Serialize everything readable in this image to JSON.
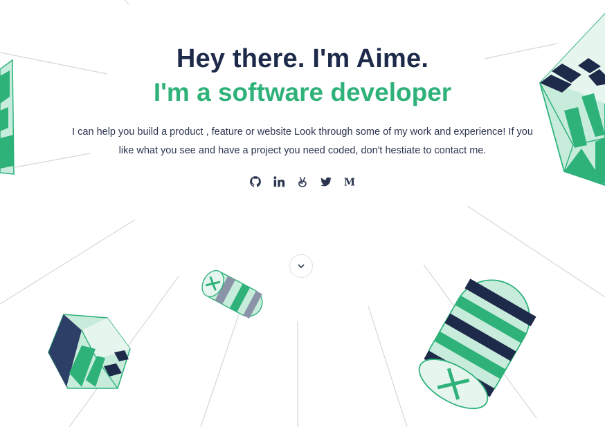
{
  "hero": {
    "greeting": "Hey there. I'm Aime.",
    "role": "I'm a software developer",
    "intro": "I can help you build a product , feature or website Look through some of my work and experience! If you like what you see and have a project you need coded, don't hestiate to contact me."
  },
  "socials": [
    {
      "icon": "github-icon"
    },
    {
      "icon": "linkedin-icon"
    },
    {
      "icon": "angellist-icon"
    },
    {
      "icon": "twitter-icon"
    },
    {
      "icon": "medium-icon"
    }
  ],
  "scroll": {
    "icon": "chevron-down-icon"
  },
  "colors": {
    "navy": "#1e2a4a",
    "green": "#2fb27a",
    "mint": "#c8ecdc",
    "slate": "#8a93a8",
    "line": "#d4d6dc"
  }
}
